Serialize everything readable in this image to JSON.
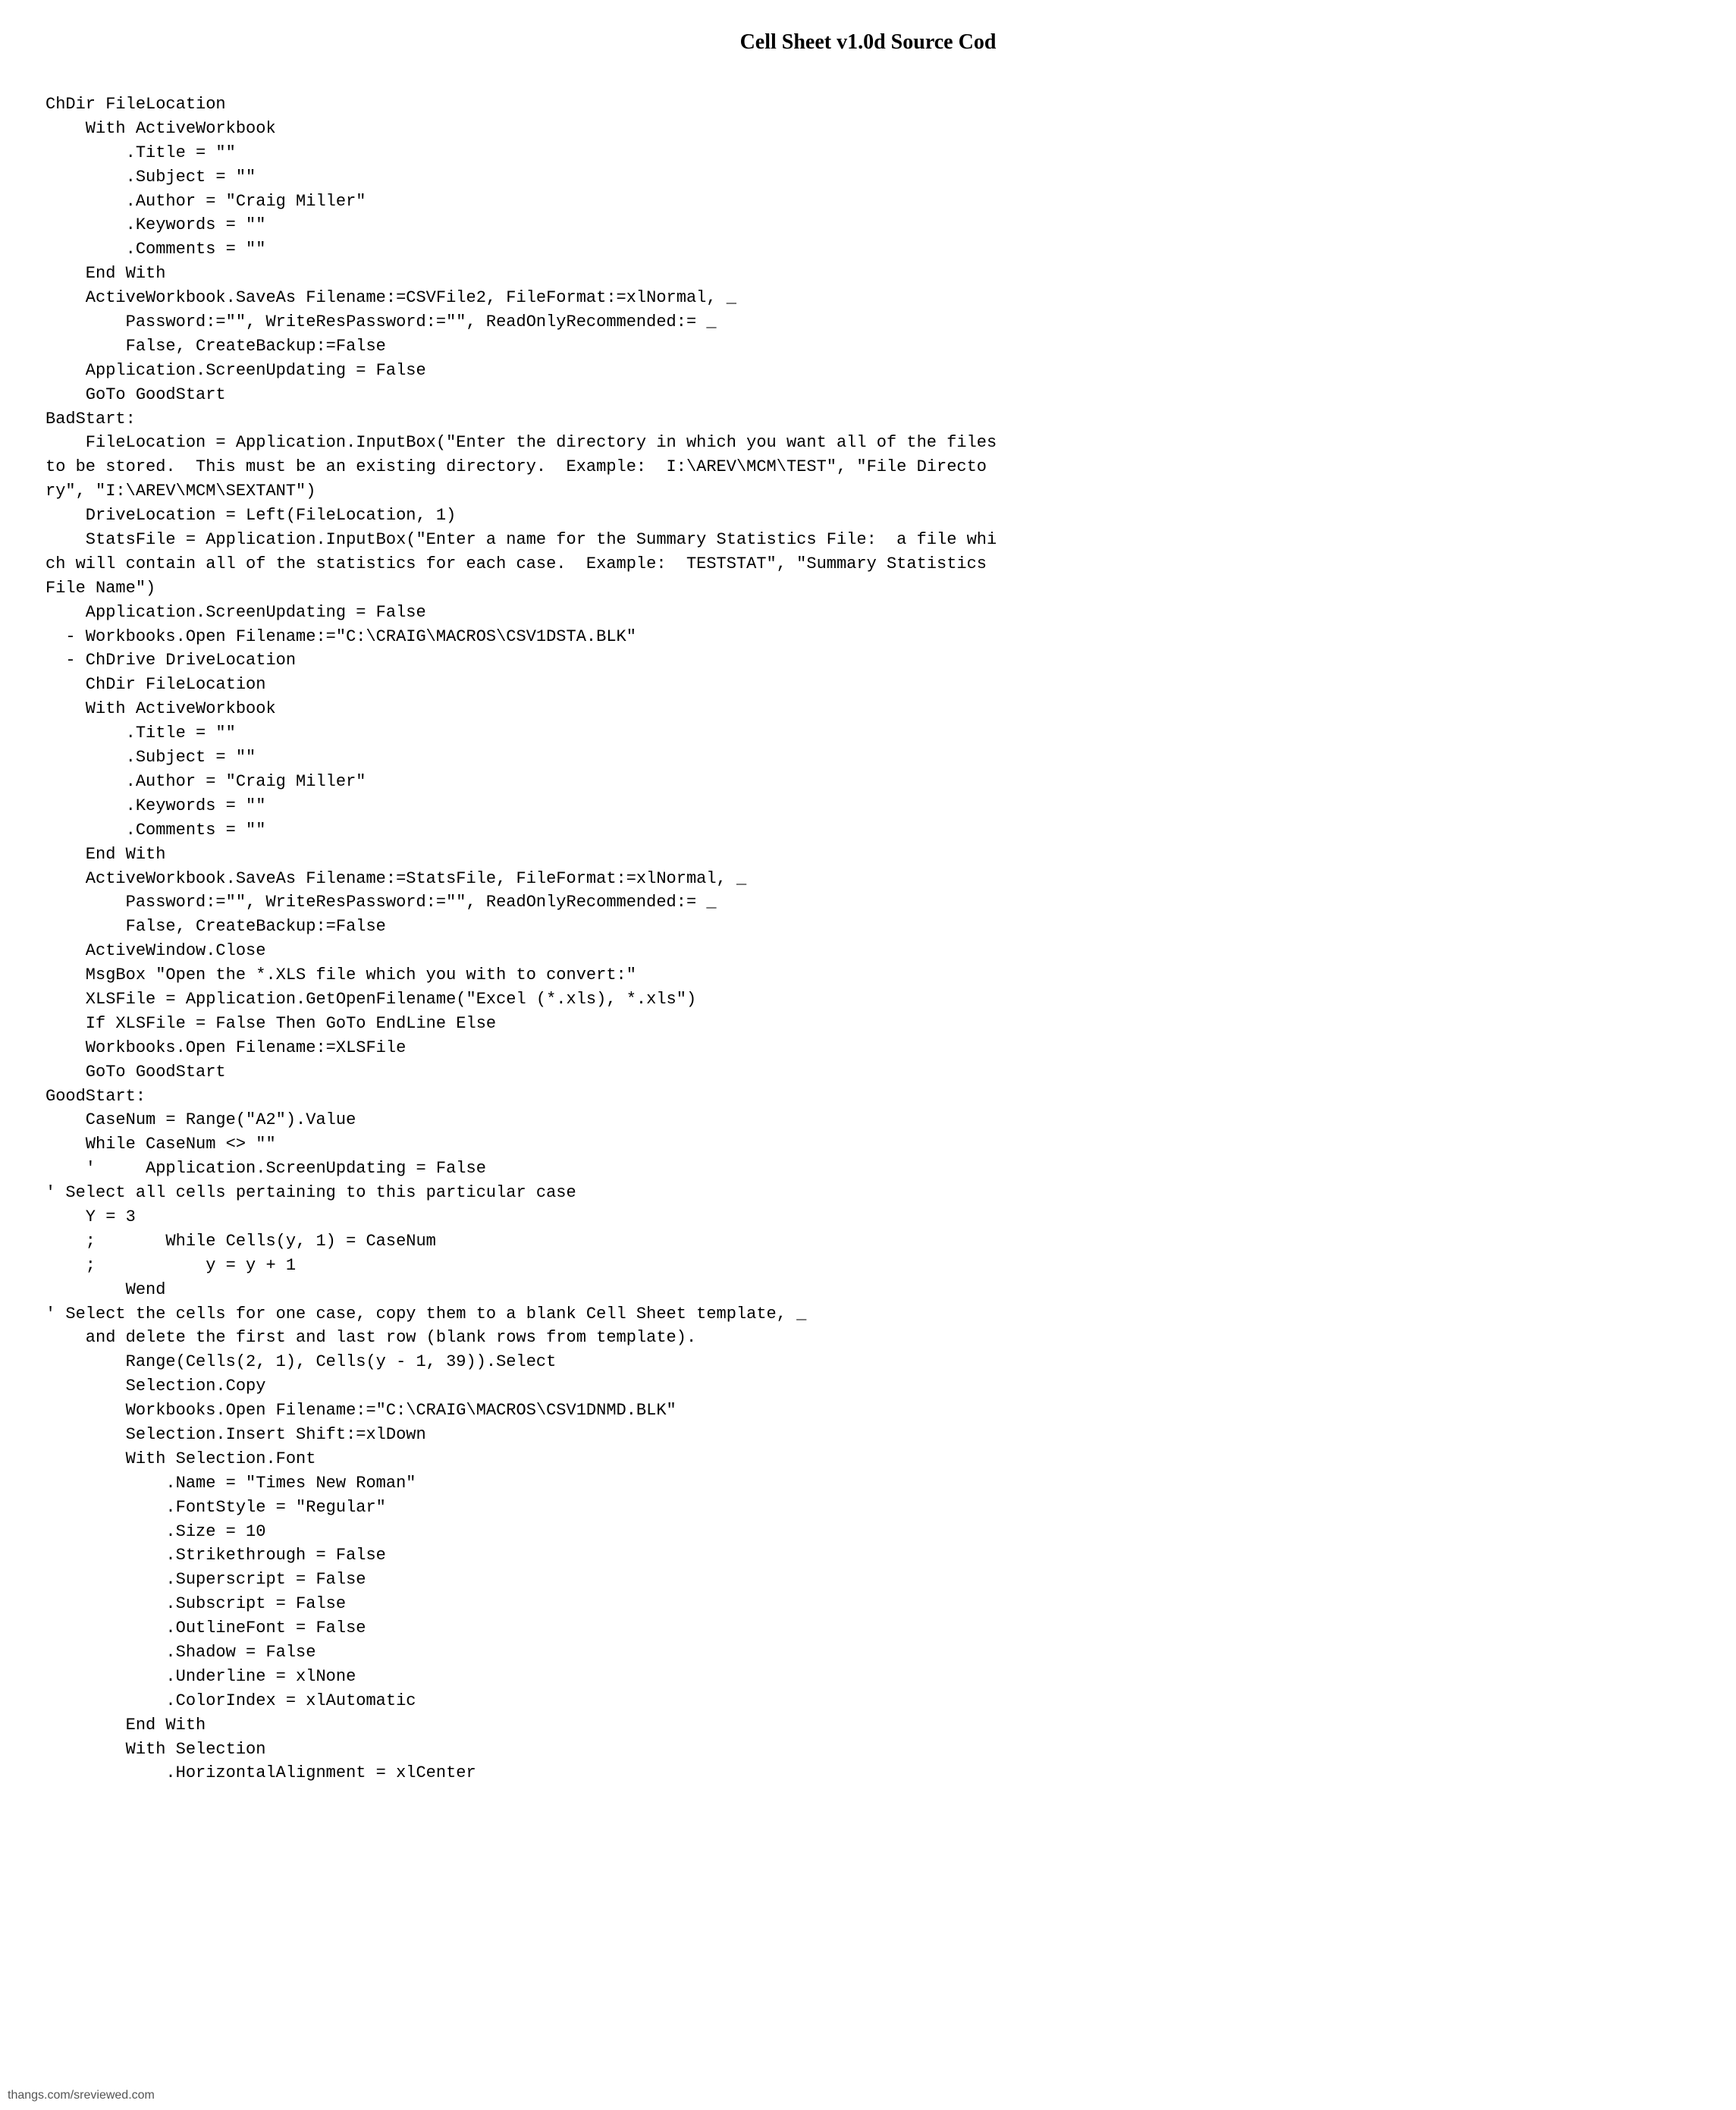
{
  "page": {
    "title": "Cell Sheet v1.0d Source Cod",
    "watermark": "thangs.com/sreviewed.com"
  },
  "code": {
    "content": "ChDir FileLocation\n    With ActiveWorkbook\n        .Title = \"\"\n        .Subject = \"\"\n        .Author = \"Craig Miller\"\n        .Keywords = \"\"\n        .Comments = \"\"\n    End With\n    ActiveWorkbook.SaveAs Filename:=CSVFile2, FileFormat:=xlNormal, _\n        Password:=\"\", WriteResPassword:=\"\", ReadOnlyRecommended:= _\n        False, CreateBackup:=False\n    Application.ScreenUpdating = False\n    GoTo GoodStart\nBadStart:\n    FileLocation = Application.InputBox(\"Enter the directory in which you want all of the files\nto be stored.  This must be an existing directory.  Example:  I:\\AREV\\MCM\\TEST\", \"File Directo\nry\", \"I:\\AREV\\MCM\\SEXTANT\")\n    DriveLocation = Left(FileLocation, 1)\n    StatsFile = Application.InputBox(\"Enter a name for the Summary Statistics File:  a file whi\nch will contain all of the statistics for each case.  Example:  TESTSTAT\", \"Summary Statistics\nFile Name\")\n    Application.ScreenUpdating = False\n  - Workbooks.Open Filename:=\"C:\\CRAIG\\MACROS\\CSV1DSTA.BLK\"\n  - ChDrive DriveLocation\n    ChDir FileLocation\n    With ActiveWorkbook\n        .Title = \"\"\n        .Subject = \"\"\n        .Author = \"Craig Miller\"\n        .Keywords = \"\"\n        .Comments = \"\"\n    End With\n    ActiveWorkbook.SaveAs Filename:=StatsFile, FileFormat:=xlNormal, _\n        Password:=\"\", WriteResPassword:=\"\", ReadOnlyRecommended:= _\n        False, CreateBackup:=False\n    ActiveWindow.Close\n    MsgBox \"Open the *.XLS file which you with to convert:\"\n    XLSFile = Application.GetOpenFilename(\"Excel (*.xls), *.xls\")\n    If XLSFile = False Then GoTo EndLine Else\n    Workbooks.Open Filename:=XLSFile\n    GoTo GoodStart\nGoodStart:\n    CaseNum = Range(\"A2\").Value\n    While CaseNum <> \"\"\n    '     Application.ScreenUpdating = False\n' Select all cells pertaining to this particular case\n    Y = 3\n    ;       While Cells(y, 1) = CaseNum\n    ;           y = y + 1\n        Wend\n' Select the cells for one case, copy them to a blank Cell Sheet template, _\n    and delete the first and last row (blank rows from template).\n        Range(Cells(2, 1), Cells(y - 1, 39)).Select\n        Selection.Copy\n        Workbooks.Open Filename:=\"C:\\CRAIG\\MACROS\\CSV1DNMD.BLK\"\n        Selection.Insert Shift:=xlDown\n        With Selection.Font\n            .Name = \"Times New Roman\"\n            .FontStyle = \"Regular\"\n            .Size = 10\n            .Strikethrough = False\n            .Superscript = False\n            .Subscript = False\n            .OutlineFont = False\n            .Shadow = False\n            .Underline = xlNone\n            .ColorIndex = xlAutomatic\n        End With\n        With Selection\n            .HorizontalAlignment = xlCenter"
  }
}
